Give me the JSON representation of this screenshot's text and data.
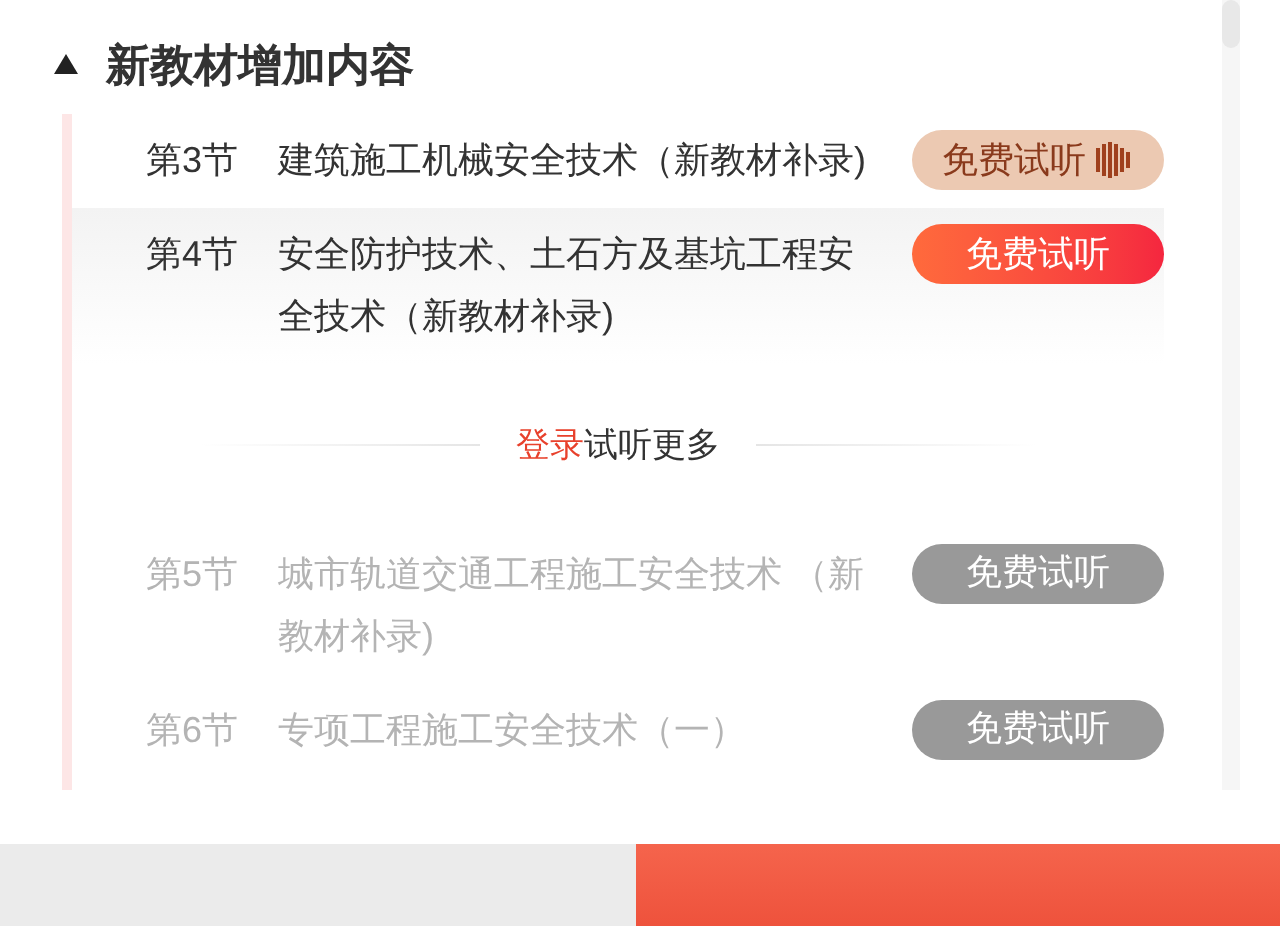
{
  "section": {
    "title": "新教材增加内容",
    "expanded": true
  },
  "lessons": [
    {
      "number": "第3节",
      "title": "建筑施工机械安全技术（新教材补录)",
      "selected": false,
      "disabled": false,
      "button": {
        "label": "免费试听",
        "kind": "playing"
      }
    },
    {
      "number": "第4节",
      "title": "安全防护技术、土石方及基坑工程安全技术（新教材补录)",
      "selected": true,
      "disabled": false,
      "button": {
        "label": "免费试听",
        "kind": "active"
      }
    }
  ],
  "login_prompt": {
    "link": "登录",
    "text": "试听更多"
  },
  "locked_lessons": [
    {
      "number": "第5节",
      "title": "城市轨道交通工程施工安全技术 （新教材补录)",
      "selected": false,
      "disabled": true,
      "button": {
        "label": "免费试听",
        "kind": "locked"
      }
    },
    {
      "number": "第6节",
      "title": "专项工程施工安全技术（一）",
      "selected": false,
      "disabled": true,
      "button": {
        "label": "免费试听",
        "kind": "locked"
      }
    }
  ]
}
